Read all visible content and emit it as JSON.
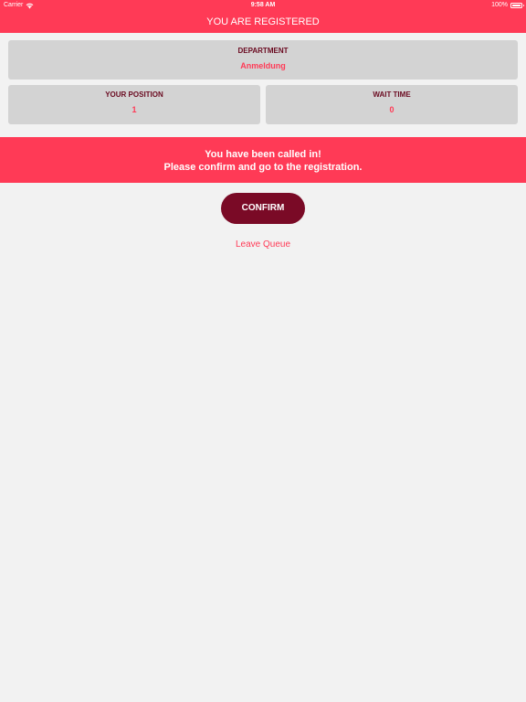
{
  "status_bar": {
    "carrier": "Carrier",
    "time": "9:58 AM",
    "battery": "100%",
    "battery_level": 1.0
  },
  "header": {
    "title": "YOU ARE REGISTERED"
  },
  "department": {
    "label": "DEPARTMENT",
    "value": "Anmeldung"
  },
  "position": {
    "label": "YOUR POSITION",
    "value": "1"
  },
  "wait_time": {
    "label": "WAIT TIME",
    "value": "0"
  },
  "banner": {
    "line1": "You have been called in!",
    "line2": "Please confirm and go to the registration."
  },
  "actions": {
    "confirm_label": "CONFIRM",
    "leave_label": "Leave Queue"
  },
  "colors": {
    "accent": "#ff3a56",
    "button": "#7a0a26",
    "card": "#d3d3d3",
    "background": "#f2f2f2",
    "label_text": "#6a0a20"
  },
  "icons": [
    "wifi-icon",
    "battery-icon"
  ]
}
